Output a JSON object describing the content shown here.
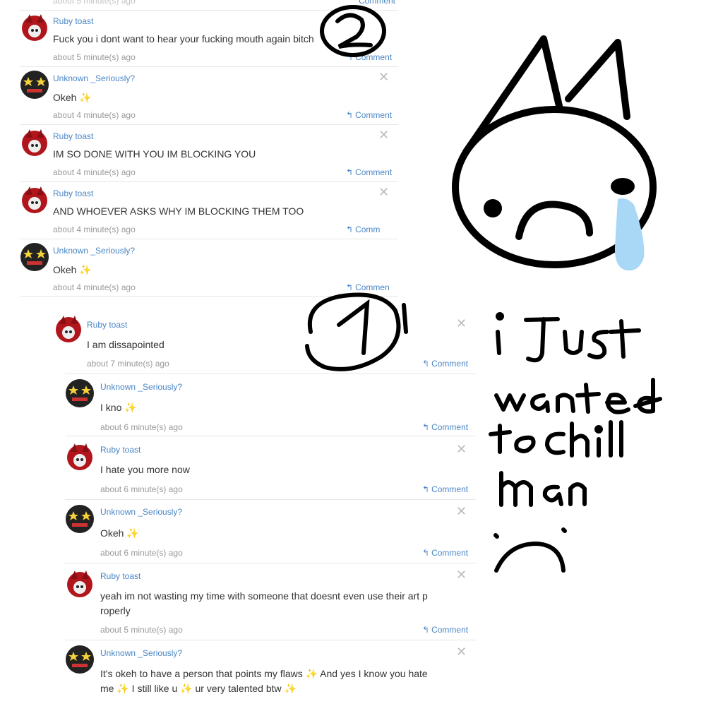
{
  "top_thread": {
    "cut_meta": "about 5 minute(s) ago",
    "cut_action": "Comment",
    "comments": [
      {
        "user": "Ruby toast",
        "text": "Fuck you i dont want to hear your fucking mouth again bitch",
        "time": "about 5 minute(s) ago",
        "action": "Comment",
        "avatar": "ruby"
      },
      {
        "user": "Unknown _Seriously?",
        "text": "Okeh",
        "spark": true,
        "time": "about 4 minute(s) ago",
        "action": "Comment",
        "avatar": "unknown"
      },
      {
        "user": "Ruby toast",
        "text": "IM SO DONE WITH YOU IM BLOCKING YOU",
        "time": "about 4 minute(s) ago",
        "action": "Comment",
        "avatar": "ruby"
      },
      {
        "user": "Ruby toast",
        "text": "AND WHOEVER ASKS WHY IM BLOCKING THEM TOO",
        "time": "about 4 minute(s) ago",
        "action": "Comm",
        "avatar": "ruby"
      },
      {
        "user": "Unknown _Seriously?",
        "text": "Okeh",
        "spark": true,
        "time": "about 4 minute(s) ago",
        "action": "Commen",
        "avatar": "unknown"
      }
    ]
  },
  "bottom_thread": {
    "parent": {
      "user": "Ruby toast",
      "text": "I am dissapointed",
      "time": "about 7 minute(s) ago",
      "action": "Comment",
      "avatar": "ruby"
    },
    "replies": [
      {
        "user": "Unknown _Seriously?",
        "text": "I kno",
        "spark": true,
        "time": "about 6 minute(s) ago",
        "action": "Comment",
        "avatar": "unknown"
      },
      {
        "user": "Ruby toast",
        "text": "I hate you more now",
        "time": "about 6 minute(s) ago",
        "action": "Comment",
        "avatar": "ruby"
      },
      {
        "user": "Unknown _Seriously?",
        "text": "Okeh",
        "spark": true,
        "time": "about 6 minute(s) ago",
        "action": "Comment",
        "avatar": "unknown"
      },
      {
        "user": "Ruby toast",
        "text": "yeah im not wasting my time with someone that doesnt even use their art p",
        "text2": "roperly",
        "time": "about 5 minute(s) ago",
        "action": "Comment",
        "avatar": "ruby"
      },
      {
        "user": "Unknown _Seriously?",
        "text": "It's okeh to have a person that points my flaws ✨ And yes I know you hate",
        "text2": "me ✨ I still like u ✨ ur very talented btw ✨",
        "avatar": "unknown"
      }
    ]
  },
  "annotations": {
    "marker_top": "2",
    "marker_bottom": "1",
    "handwritten": [
      "i Just",
      "wanted",
      "to chill",
      "man"
    ]
  },
  "colors": {
    "link": "#4a86c5",
    "meta": "#9a9a9a",
    "text": "#333333",
    "tear": "#a8d8f5",
    "sparkle": "#f2c83a"
  }
}
